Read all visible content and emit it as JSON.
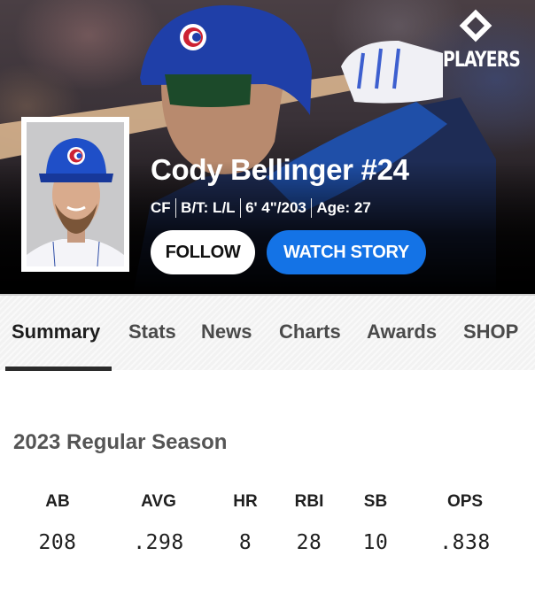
{
  "hero": {
    "brand_logo": {
      "icon": "diamond-icon",
      "text": "PLAYERS"
    },
    "player": {
      "name": "Cody Bellinger #24",
      "position": "CF",
      "bats_throws": "B/T: L/L",
      "height_weight": "6' 4\"/203",
      "age": "Age: 27"
    },
    "buttons": {
      "follow": "FOLLOW",
      "watch_story": "WATCH STORY"
    },
    "colors": {
      "watch_story_bg": "#1473e6",
      "follow_bg": "#ffffff",
      "cubs_blue": "#1a46b8",
      "cubs_red": "#cc2233"
    }
  },
  "tabs": [
    {
      "label": "Summary",
      "active": true
    },
    {
      "label": "Stats",
      "active": false
    },
    {
      "label": "News",
      "active": false
    },
    {
      "label": "Charts",
      "active": false
    },
    {
      "label": "Awards",
      "active": false
    },
    {
      "label": "SHOP",
      "active": false
    }
  ],
  "season": {
    "title": "2023 Regular Season",
    "stats": [
      {
        "label": "AB",
        "value": "208"
      },
      {
        "label": "AVG",
        "value": ".298"
      },
      {
        "label": "HR",
        "value": "8"
      },
      {
        "label": "RBI",
        "value": "28"
      },
      {
        "label": "SB",
        "value": "10"
      },
      {
        "label": "OPS",
        "value": ".838"
      }
    ]
  }
}
